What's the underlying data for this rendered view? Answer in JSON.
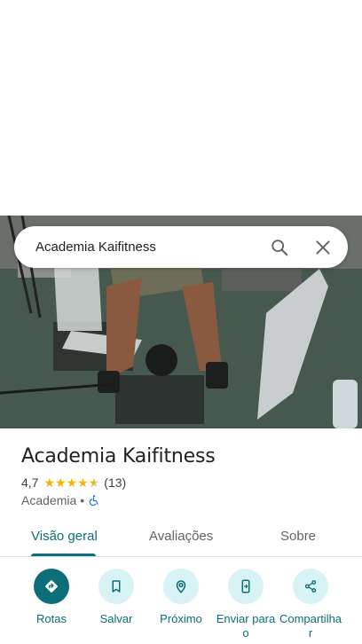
{
  "search": {
    "query": "Academia Kaifitness"
  },
  "place": {
    "name": "Academia Kaifitness",
    "rating": "4,7",
    "review_count": "(13)",
    "stars_value": 4.7,
    "category": "Academia",
    "separator": "•"
  },
  "tabs": [
    {
      "label": "Visão geral",
      "active": true
    },
    {
      "label": "Avaliações",
      "active": false
    },
    {
      "label": "Sobre",
      "active": false
    }
  ],
  "actions": [
    {
      "label": "Rotas",
      "icon": "directions-icon"
    },
    {
      "label": "Salvar",
      "icon": "bookmark-icon"
    },
    {
      "label": "Próximo",
      "icon": "nearby-icon"
    },
    {
      "label": "Enviar para o",
      "icon": "send-to-phone-icon"
    },
    {
      "label": "Compartilha r",
      "icon": "share-icon"
    }
  ],
  "colors": {
    "accent": "#0b6e78",
    "accent_light": "#d8f3f6",
    "star": "#f5b400"
  }
}
